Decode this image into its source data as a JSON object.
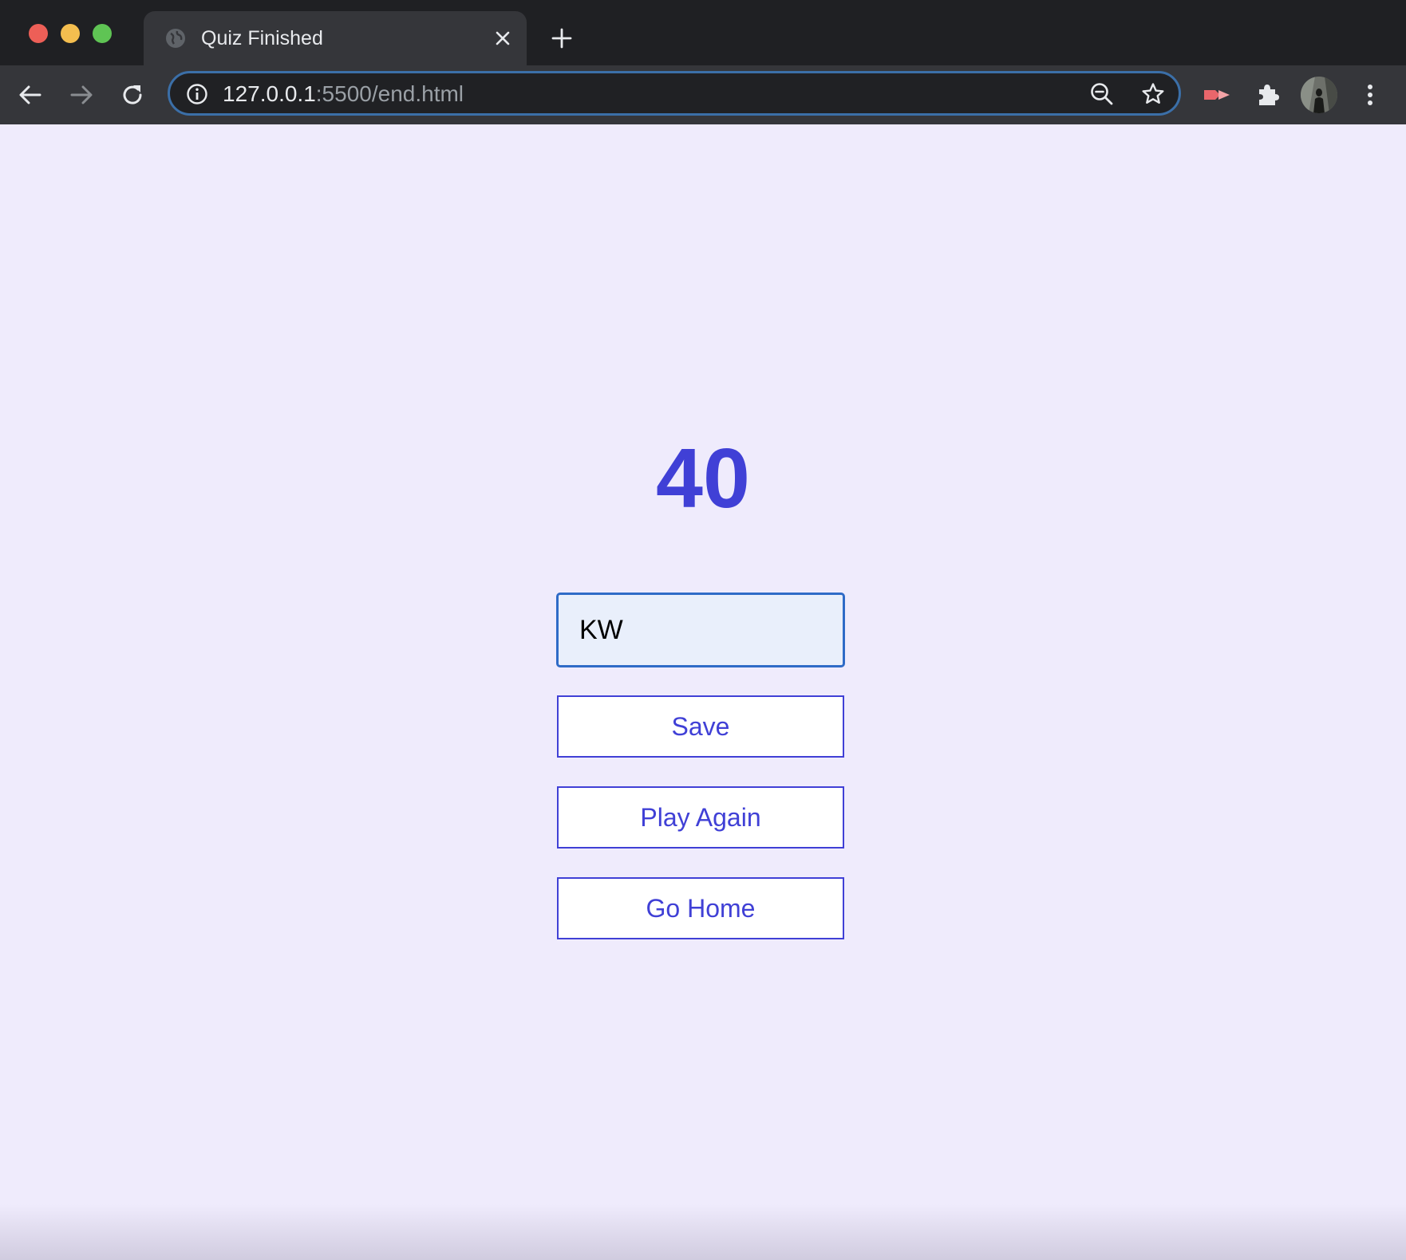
{
  "browser": {
    "tab_title": "Quiz Finished",
    "url_host": "127.0.0.1",
    "url_path": ":5500/end.html"
  },
  "page": {
    "score": "40",
    "username_value": "KW",
    "save_label": "Save",
    "play_again_label": "Play Again",
    "go_home_label": "Go Home"
  },
  "colors": {
    "accent": "#4040d6",
    "page_background": "#efebfc",
    "input_background": "#e9effb",
    "input_border": "#2f6bc7"
  },
  "icons": {
    "traffic_lights": [
      "close-window",
      "minimize-window",
      "maximize-window"
    ],
    "toolbar": [
      "back-arrow-icon",
      "forward-arrow-icon",
      "reload-icon",
      "site-info-icon",
      "zoom-out-icon",
      "bookmark-star-icon",
      "extension-video-icon",
      "extensions-puzzle-icon",
      "profile-avatar",
      "more-menu-icon"
    ]
  }
}
